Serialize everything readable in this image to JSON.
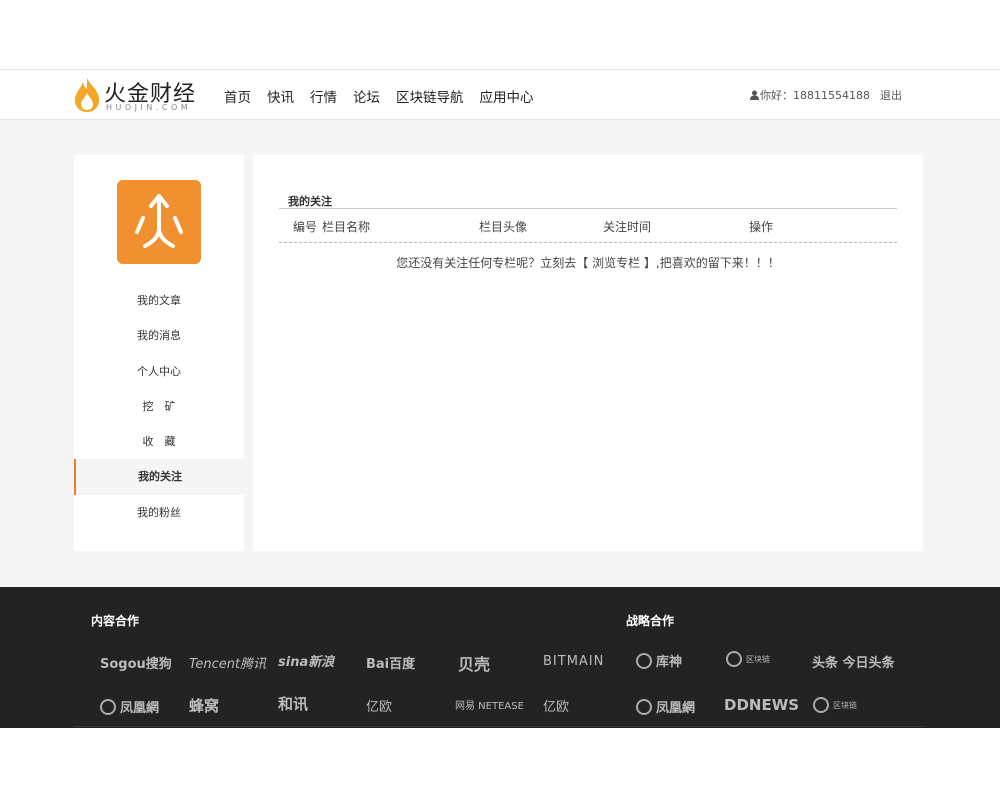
{
  "header": {
    "logo_text": "火金财经",
    "logo_sub": "HUOJIN.COM",
    "nav": [
      "首页",
      "快讯",
      "行情",
      "论坛",
      "区块链导航",
      "应用中心"
    ],
    "greeting": "你好：18811554188",
    "logout": "退出"
  },
  "sidebar": {
    "menu": [
      {
        "label": "我的文章"
      },
      {
        "label": "我的消息"
      },
      {
        "label": "个人中心"
      },
      {
        "label": "挖　矿"
      },
      {
        "label": "收　藏"
      },
      {
        "label": "我的关注"
      },
      {
        "label": "我的粉丝"
      }
    ],
    "active_index": 5
  },
  "content": {
    "title": "我的关注",
    "columns": [
      "编号",
      "栏目名称",
      "栏目头像",
      "关注时间",
      "操作"
    ],
    "empty_message": "您还没有关注任何专栏呢？立刻去【 浏览专栏 】,把喜欢的留下来！！！"
  },
  "footer": {
    "content_partners_title": "内容合作",
    "strategic_partners_title": "战略合作",
    "partners_row1": [
      "Sogou搜狗",
      "Tencent腾讯",
      "sina新浪",
      "Bai百度",
      "贝壳",
      "BITMAIN",
      "库神",
      "区块链",
      "头条 今日头条"
    ],
    "partners_row2": [
      "凤凰網",
      "蜂窝",
      "和讯",
      "亿欧",
      "网易 NETEASE",
      "亿欧",
      "凤凰網",
      "DDNEWS",
      "区块链"
    ]
  },
  "colors": {
    "accent": "#f07d2f",
    "avatar_bg": "#f0902f",
    "footer_bg": "#232323"
  }
}
